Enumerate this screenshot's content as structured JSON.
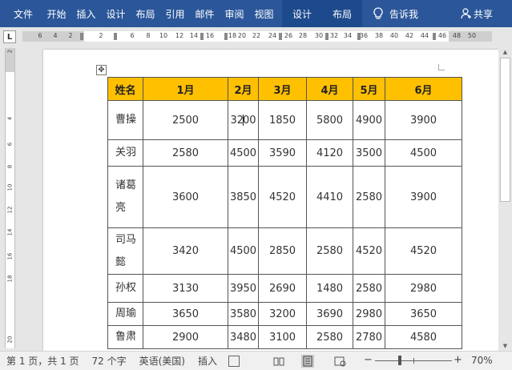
{
  "ribbon": {
    "tabs": [
      "文件",
      "开始",
      "插入",
      "设计",
      "布局",
      "引用",
      "邮件",
      "审阅",
      "视图"
    ],
    "context_tabs": [
      "设计",
      "布局"
    ],
    "tell_me": "告诉我",
    "share": "共享",
    "background": "#2b579a"
  },
  "ruler": {
    "tab_selector": "L",
    "numbers": [
      "6",
      "4",
      "2",
      "2",
      "6",
      "8",
      "10",
      "12",
      "14",
      "16",
      "18",
      "20",
      "22",
      "24",
      "26",
      "28",
      "30",
      "32",
      "34",
      "36",
      "38",
      "40",
      "42",
      "44",
      "46",
      "48",
      "50"
    ],
    "vertical_numbers": [
      "2",
      "4",
      "6",
      "8",
      "10",
      "12",
      "14",
      "16",
      "18",
      "20"
    ]
  },
  "table": {
    "header_color": "#ffc000",
    "headers": [
      "姓名",
      "1月",
      "2月",
      "3月",
      "4月",
      "5月",
      "6月"
    ],
    "rows": [
      {
        "name": "曹操",
        "values": [
          "2500",
          "3200",
          "1850",
          "5800",
          "4900",
          "3900"
        ]
      },
      {
        "name": "关羽",
        "values": [
          "2580",
          "4500",
          "3590",
          "4120",
          "3500",
          "4500"
        ]
      },
      {
        "name": "诸葛\n亮",
        "name_line1": "诸葛",
        "name_line2": "亮",
        "values": [
          "3600",
          "3850",
          "4520",
          "4410",
          "2580",
          "3900"
        ]
      },
      {
        "name": "司马\n懿",
        "name_line1": "司马",
        "name_line2": "懿",
        "values": [
          "3420",
          "4500",
          "2850",
          "2580",
          "4520",
          "4520"
        ]
      },
      {
        "name": "孙权",
        "values": [
          "3130",
          "3950",
          "2690",
          "1480",
          "2580",
          "2980"
        ]
      },
      {
        "name": "周瑜",
        "values": [
          "3650",
          "3580",
          "3200",
          "3690",
          "2980",
          "3650"
        ]
      },
      {
        "name": "鲁肃",
        "values": [
          "2900",
          "3480",
          "3100",
          "2580",
          "2780",
          "4580"
        ]
      }
    ]
  },
  "status": {
    "page": "第 1 页，共 1 页",
    "words": "72 个字",
    "language": "英语(美国)",
    "mode": "插入",
    "zoom_minus": "−",
    "zoom_plus": "+",
    "zoom": "70%"
  }
}
